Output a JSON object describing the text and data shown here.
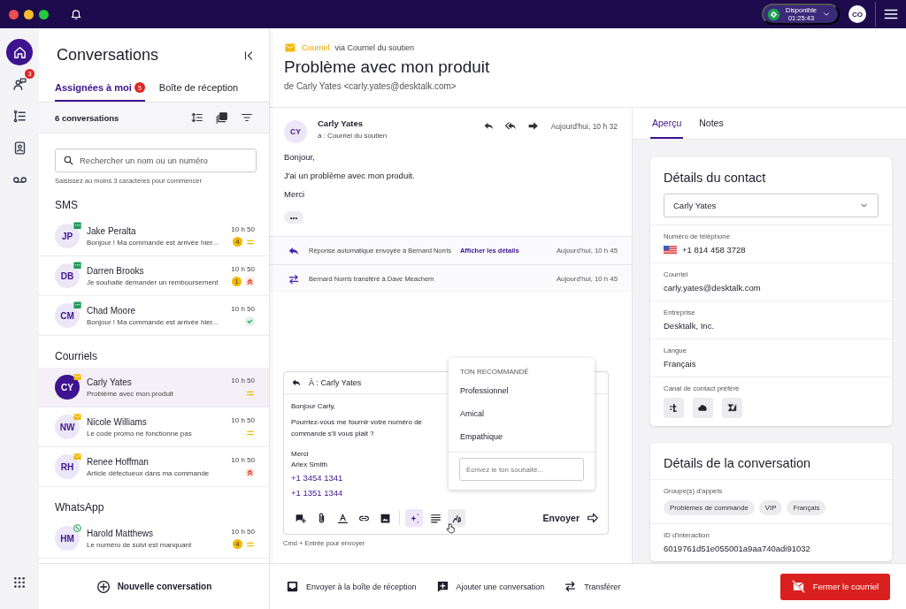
{
  "top_bar": {
    "status": {
      "label": "Disponible",
      "timer": "01:25:43"
    },
    "user_initials": "CO"
  },
  "rail": {
    "items": [
      {
        "selected": true
      },
      {
        "selected": false,
        "badge": "3"
      },
      {
        "selected": false
      },
      {
        "selected": false
      },
      {
        "selected": false
      }
    ]
  },
  "conversations": {
    "title": "Conversations",
    "tabs": [
      {
        "label": "Assignées à moi",
        "selected": true,
        "badge": "5"
      },
      {
        "label": "Boîte de réception",
        "selected": false
      }
    ],
    "count": "6 conversations",
    "search": {
      "placeholder": "Rechercher un nom ou un numéro"
    },
    "hint": "Saisissez au moins 3 caractères pour commencer",
    "groups": [
      {
        "title": "SMS",
        "kind": "sms",
        "items": [
          {
            "initials": "JP",
            "name": "Jake Peralta",
            "preview": "Bonjour ! Ma commande est arrivée hier...",
            "time": "10 h 50",
            "unread": "4",
            "priority": {
              "kind": "medium"
            },
            "selected": false
          },
          {
            "initials": "DB",
            "name": "Darren Brooks",
            "preview": "Je souhaite demander un remboursement",
            "time": "10 h 50",
            "unread": "1",
            "priority": {
              "kind": "high"
            },
            "selected": false
          },
          {
            "initials": "CM",
            "name": "Chad Moore",
            "preview": "Bonjour ! Ma commande est arrivée hier...",
            "time": "10 h 50",
            "priority": {
              "kind": "resolved"
            },
            "selected": false
          }
        ]
      },
      {
        "title": "Courriels",
        "kind": "email",
        "items": [
          {
            "initials": "CY",
            "name": "Carly Yates",
            "preview": "Problème avec mon produit",
            "time": "10 h 50",
            "priority": {
              "kind": "medium"
            },
            "selected": true
          },
          {
            "initials": "NW",
            "name": "Nicole Williams",
            "preview": "Le code promo ne fonctionne pas",
            "time": "10 h 50",
            "priority": {
              "kind": "medium"
            },
            "selected": false
          },
          {
            "initials": "RH",
            "name": "Renee Hoffman",
            "preview": "Article défectueux dans ma commande",
            "time": "10 h 50",
            "priority": {
              "kind": "high"
            },
            "selected": false
          }
        ]
      },
      {
        "title": "WhatsApp",
        "kind": "whatsapp",
        "items": [
          {
            "initials": "HM",
            "name": "Harold Matthews",
            "preview": "Le numéro de suivi est manquant",
            "time": "10 h 50",
            "unread": "4",
            "priority": {
              "kind": "medium"
            },
            "selected": false
          }
        ]
      }
    ],
    "new_button": "Nouvelle conversation"
  },
  "email": {
    "channel": "Courriel",
    "via": "via Courriel du soutien",
    "subject": "Problème avec mon produit",
    "from": "de Carly Yates <carly.yates@desktalk.com>",
    "message": {
      "initials": "CY",
      "sender": "Carly Yates",
      "to": "à : Courriel du soutien",
      "time": "Aujourd'hui, 10 h 32",
      "body": [
        "Bonjour,",
        "J'ai un problème avec mon produit.",
        "Merci"
      ],
      "more": "•••"
    },
    "events": [
      {
        "kind": "reply",
        "text": "Réponse automatique envoyée à Bernard Norris",
        "link": "Afficher les détails",
        "time": "Aujourd'hui, 10 h 45"
      },
      {
        "kind": "transfer",
        "text": "Bernard Norris transféré à Dave Meachem",
        "time": "Aujourd'hui, 10 h 45"
      }
    ]
  },
  "composer": {
    "to_label": "À :",
    "to": "Carly Yates",
    "body": [
      "Bonjour Carly,",
      "Pourriez-vous me fournir votre numéro de commande s'il vous plait ?"
    ],
    "signature": [
      "Merci",
      "Arlex Smith"
    ],
    "phones": [
      "+1 3454 1341",
      "+1 1351 1344"
    ],
    "tools": [
      {
        "on": false,
        "open": false
      },
      {
        "on": false,
        "open": false
      },
      {
        "on": false,
        "open": false
      },
      {
        "on": false,
        "open": false
      },
      {
        "on": false,
        "open": false
      },
      {
        "on": true,
        "open": false
      },
      {
        "on": false,
        "open": false
      },
      {
        "on": false,
        "open": true
      }
    ],
    "send": "Envoyer",
    "hint": "Cmd + Entrée pour envoyer",
    "tone_menu": {
      "title": "TON RECOMMANDÉ",
      "options": [
        "Professionnel",
        "Amical",
        "Empathique"
      ],
      "placeholder": "Écrivez le ton souhaité..."
    }
  },
  "actions": [
    {
      "kind": "inbox",
      "label": "Envoyer à la boîte de réception"
    },
    {
      "kind": "add",
      "label": "Ajouter une conversation"
    },
    {
      "kind": "transfer",
      "label": "Transférer"
    }
  ],
  "close_button": "Fermer le courriel",
  "details": {
    "tabs": [
      {
        "label": "Aperçu",
        "selected": true
      },
      {
        "label": "Notes",
        "selected": false
      }
    ],
    "contact": {
      "title": "Détails du contact",
      "select": "Carly Yates",
      "fields": [
        {
          "kind": "phone",
          "label": "Numéro de téléphone",
          "value": "+1 814 458 3728"
        },
        {
          "kind": "text",
          "label": "Courriel",
          "value": "carly.yates@desktalk.com"
        },
        {
          "kind": "text",
          "label": "Entreprise",
          "value": "Desktalk, Inc."
        },
        {
          "kind": "text",
          "label": "Langue",
          "value": "Français"
        },
        {
          "kind": "channels",
          "label": "Canal de contact préféré"
        }
      ]
    },
    "conversation": {
      "title": "Détails de la conversation",
      "fields": [
        {
          "kind": "tags",
          "label": "Groupe(s) d'appels",
          "tags": [
            "Problèmes de commande",
            "VIP",
            "Français"
          ]
        },
        {
          "kind": "text",
          "label": "ID d'interaction",
          "value": "6019761d51e055001a9aa740adi91032"
        }
      ]
    }
  }
}
